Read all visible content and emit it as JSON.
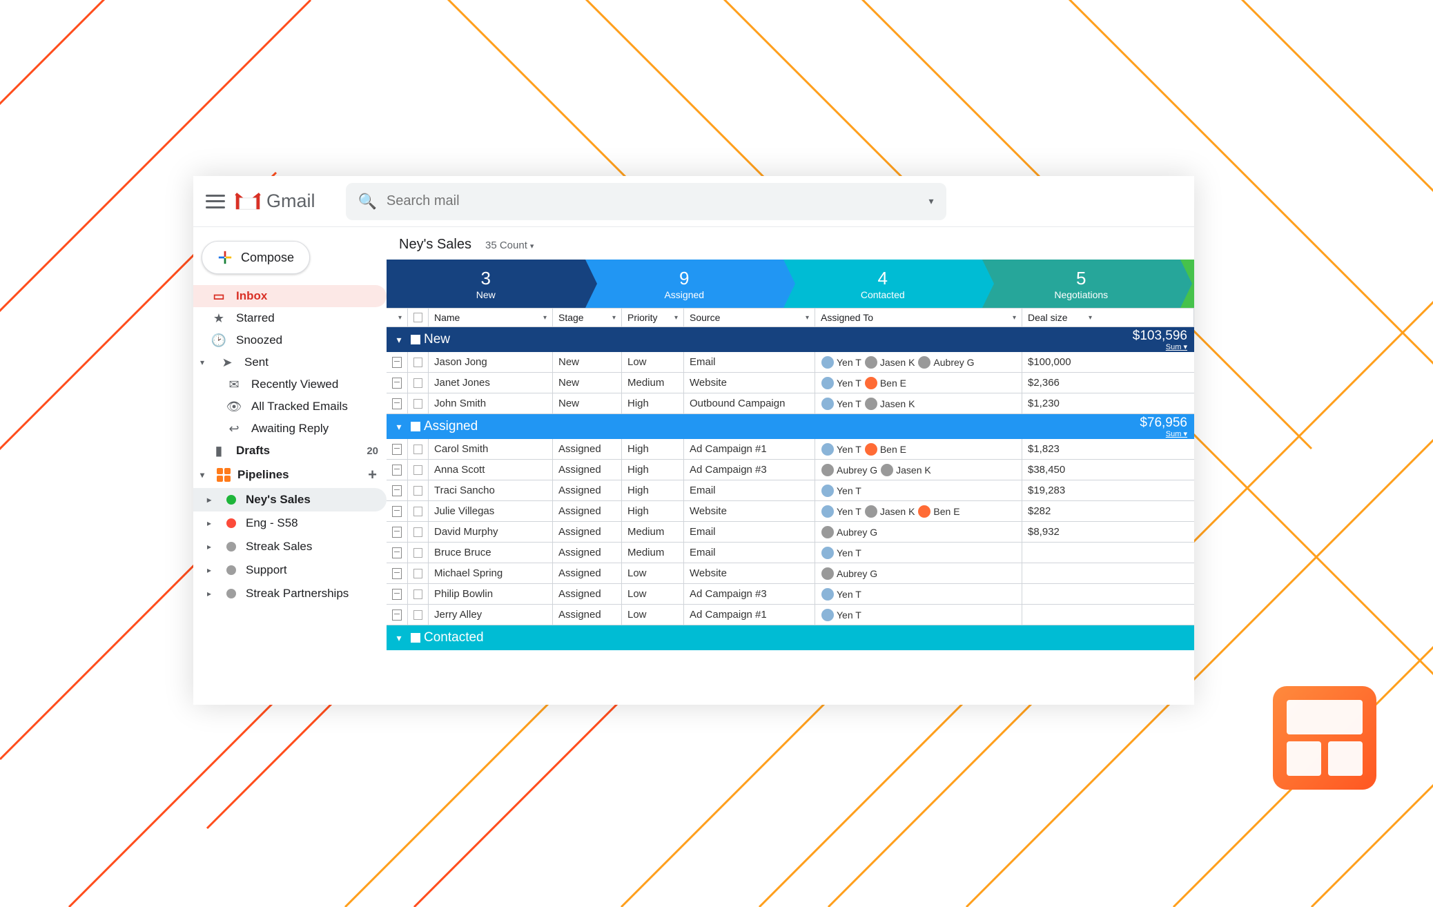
{
  "app_name": "Gmail",
  "search": {
    "placeholder": "Search mail"
  },
  "compose_label": "Compose",
  "sidebar": {
    "items": [
      {
        "label": "Inbox",
        "icon": "inbox"
      },
      {
        "label": "Starred",
        "icon": "star"
      },
      {
        "label": "Snoozed",
        "icon": "clock"
      },
      {
        "label": "Sent",
        "icon": "send"
      },
      {
        "label": "Recently Viewed",
        "icon": "mail"
      },
      {
        "label": "All Tracked Emails",
        "icon": "eye"
      },
      {
        "label": "Awaiting Reply",
        "icon": "reply"
      },
      {
        "label": "Drafts",
        "icon": "doc",
        "count": "20"
      }
    ],
    "pipelines_label": "Pipelines",
    "pipelines": [
      {
        "name": "Ney's Sales",
        "color": "#1eb53a"
      },
      {
        "name": "Eng - S58",
        "color": "#fc4b3a"
      },
      {
        "name": "Streak Sales",
        "color": "#9e9e9e"
      },
      {
        "name": "Support",
        "color": "#9e9e9e"
      },
      {
        "name": "Streak Partnerships",
        "color": "#9e9e9e"
      }
    ]
  },
  "pipeline_view": {
    "title": "Ney's Sales",
    "count_label": "35 Count",
    "stages": [
      {
        "num": "3",
        "name": "New"
      },
      {
        "num": "9",
        "name": "Assigned"
      },
      {
        "num": "4",
        "name": "Contacted"
      },
      {
        "num": "5",
        "name": "Negotiations"
      }
    ],
    "columns": [
      "Name",
      "Stage",
      "Priority",
      "Source",
      "Assigned To",
      "Deal size"
    ],
    "groups": [
      {
        "label": "New",
        "total": "$103,596",
        "sum_label": "Sum",
        "class": "gh-new",
        "rows": [
          {
            "name": "Jason Jong",
            "stage": "New",
            "prio": "Low",
            "src": "Email",
            "assn": [
              {
                "n": "Yen T",
                "c": "bl"
              },
              {
                "n": "Jasen K",
                "c": "gr"
              },
              {
                "n": "Aubrey G",
                "c": "gr"
              }
            ],
            "deal": "$100,000"
          },
          {
            "name": "Janet Jones",
            "stage": "New",
            "prio": "Medium",
            "src": "Website",
            "assn": [
              {
                "n": "Yen T",
                "c": "bl"
              },
              {
                "n": "Ben E",
                "c": "or"
              }
            ],
            "deal": "$2,366"
          },
          {
            "name": "John Smith",
            "stage": "New",
            "prio": "High",
            "src": "Outbound Campaign",
            "assn": [
              {
                "n": "Yen T",
                "c": "bl"
              },
              {
                "n": "Jasen K",
                "c": "gr"
              }
            ],
            "deal": "$1,230"
          }
        ]
      },
      {
        "label": "Assigned",
        "total": "$76,956",
        "sum_label": "Sum",
        "class": "gh-ass",
        "rows": [
          {
            "name": "Carol Smith",
            "stage": "Assigned",
            "prio": "High",
            "src": "Ad Campaign #1",
            "assn": [
              {
                "n": "Yen T",
                "c": "bl"
              },
              {
                "n": "Ben E",
                "c": "or"
              }
            ],
            "deal": "$1,823"
          },
          {
            "name": "Anna Scott",
            "stage": "Assigned",
            "prio": "High",
            "src": "Ad Campaign #3",
            "assn": [
              {
                "n": "Aubrey G",
                "c": "gr"
              },
              {
                "n": "Jasen K",
                "c": "gr"
              }
            ],
            "deal": "$38,450"
          },
          {
            "name": "Traci Sancho",
            "stage": "Assigned",
            "prio": "High",
            "src": "Email",
            "assn": [
              {
                "n": "Yen T",
                "c": "bl"
              }
            ],
            "deal": "$19,283"
          },
          {
            "name": "Julie Villegas",
            "stage": "Assigned",
            "prio": "High",
            "src": "Website",
            "assn": [
              {
                "n": "Yen T",
                "c": "bl"
              },
              {
                "n": "Jasen K",
                "c": "gr"
              },
              {
                "n": "Ben E",
                "c": "or"
              }
            ],
            "deal": "$282"
          },
          {
            "name": "David Murphy",
            "stage": "Assigned",
            "prio": "Medium",
            "src": "Email",
            "assn": [
              {
                "n": "Aubrey G",
                "c": "gr"
              }
            ],
            "deal": "$8,932"
          },
          {
            "name": "Bruce Bruce",
            "stage": "Assigned",
            "prio": "Medium",
            "src": "Email",
            "assn": [
              {
                "n": "Yen T",
                "c": "bl"
              }
            ],
            "deal": ""
          },
          {
            "name": "Michael Spring",
            "stage": "Assigned",
            "prio": "Low",
            "src": "Website",
            "assn": [
              {
                "n": "Aubrey G",
                "c": "gr"
              }
            ],
            "deal": ""
          },
          {
            "name": "Philip Bowlin",
            "stage": "Assigned",
            "prio": "Low",
            "src": "Ad Campaign #3",
            "assn": [
              {
                "n": "Yen T",
                "c": "bl"
              }
            ],
            "deal": ""
          },
          {
            "name": "Jerry Alley",
            "stage": "Assigned",
            "prio": "Low",
            "src": "Ad Campaign #1",
            "assn": [
              {
                "n": "Yen T",
                "c": "bl"
              }
            ],
            "deal": ""
          }
        ]
      },
      {
        "label": "Contacted",
        "total": "",
        "sum_label": "",
        "class": "gh-con",
        "rows": []
      }
    ]
  }
}
